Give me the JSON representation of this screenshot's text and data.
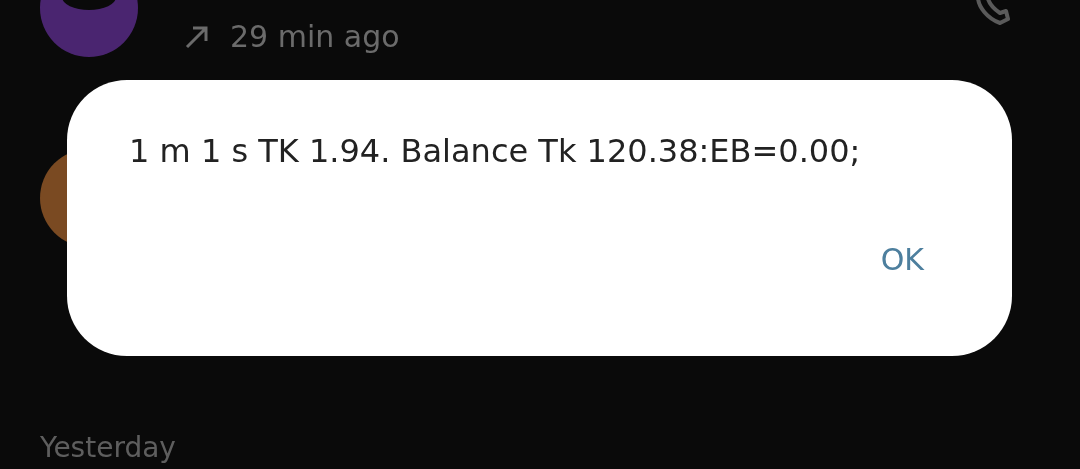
{
  "call_log": {
    "entries": [
      {
        "time": "29 min ago"
      }
    ],
    "section_header": "Yesterday"
  },
  "dialog": {
    "message": "1 m 1 s TK 1.94. Balance Tk 120.38:EB=0.00;",
    "buttons": [
      "OK"
    ]
  }
}
